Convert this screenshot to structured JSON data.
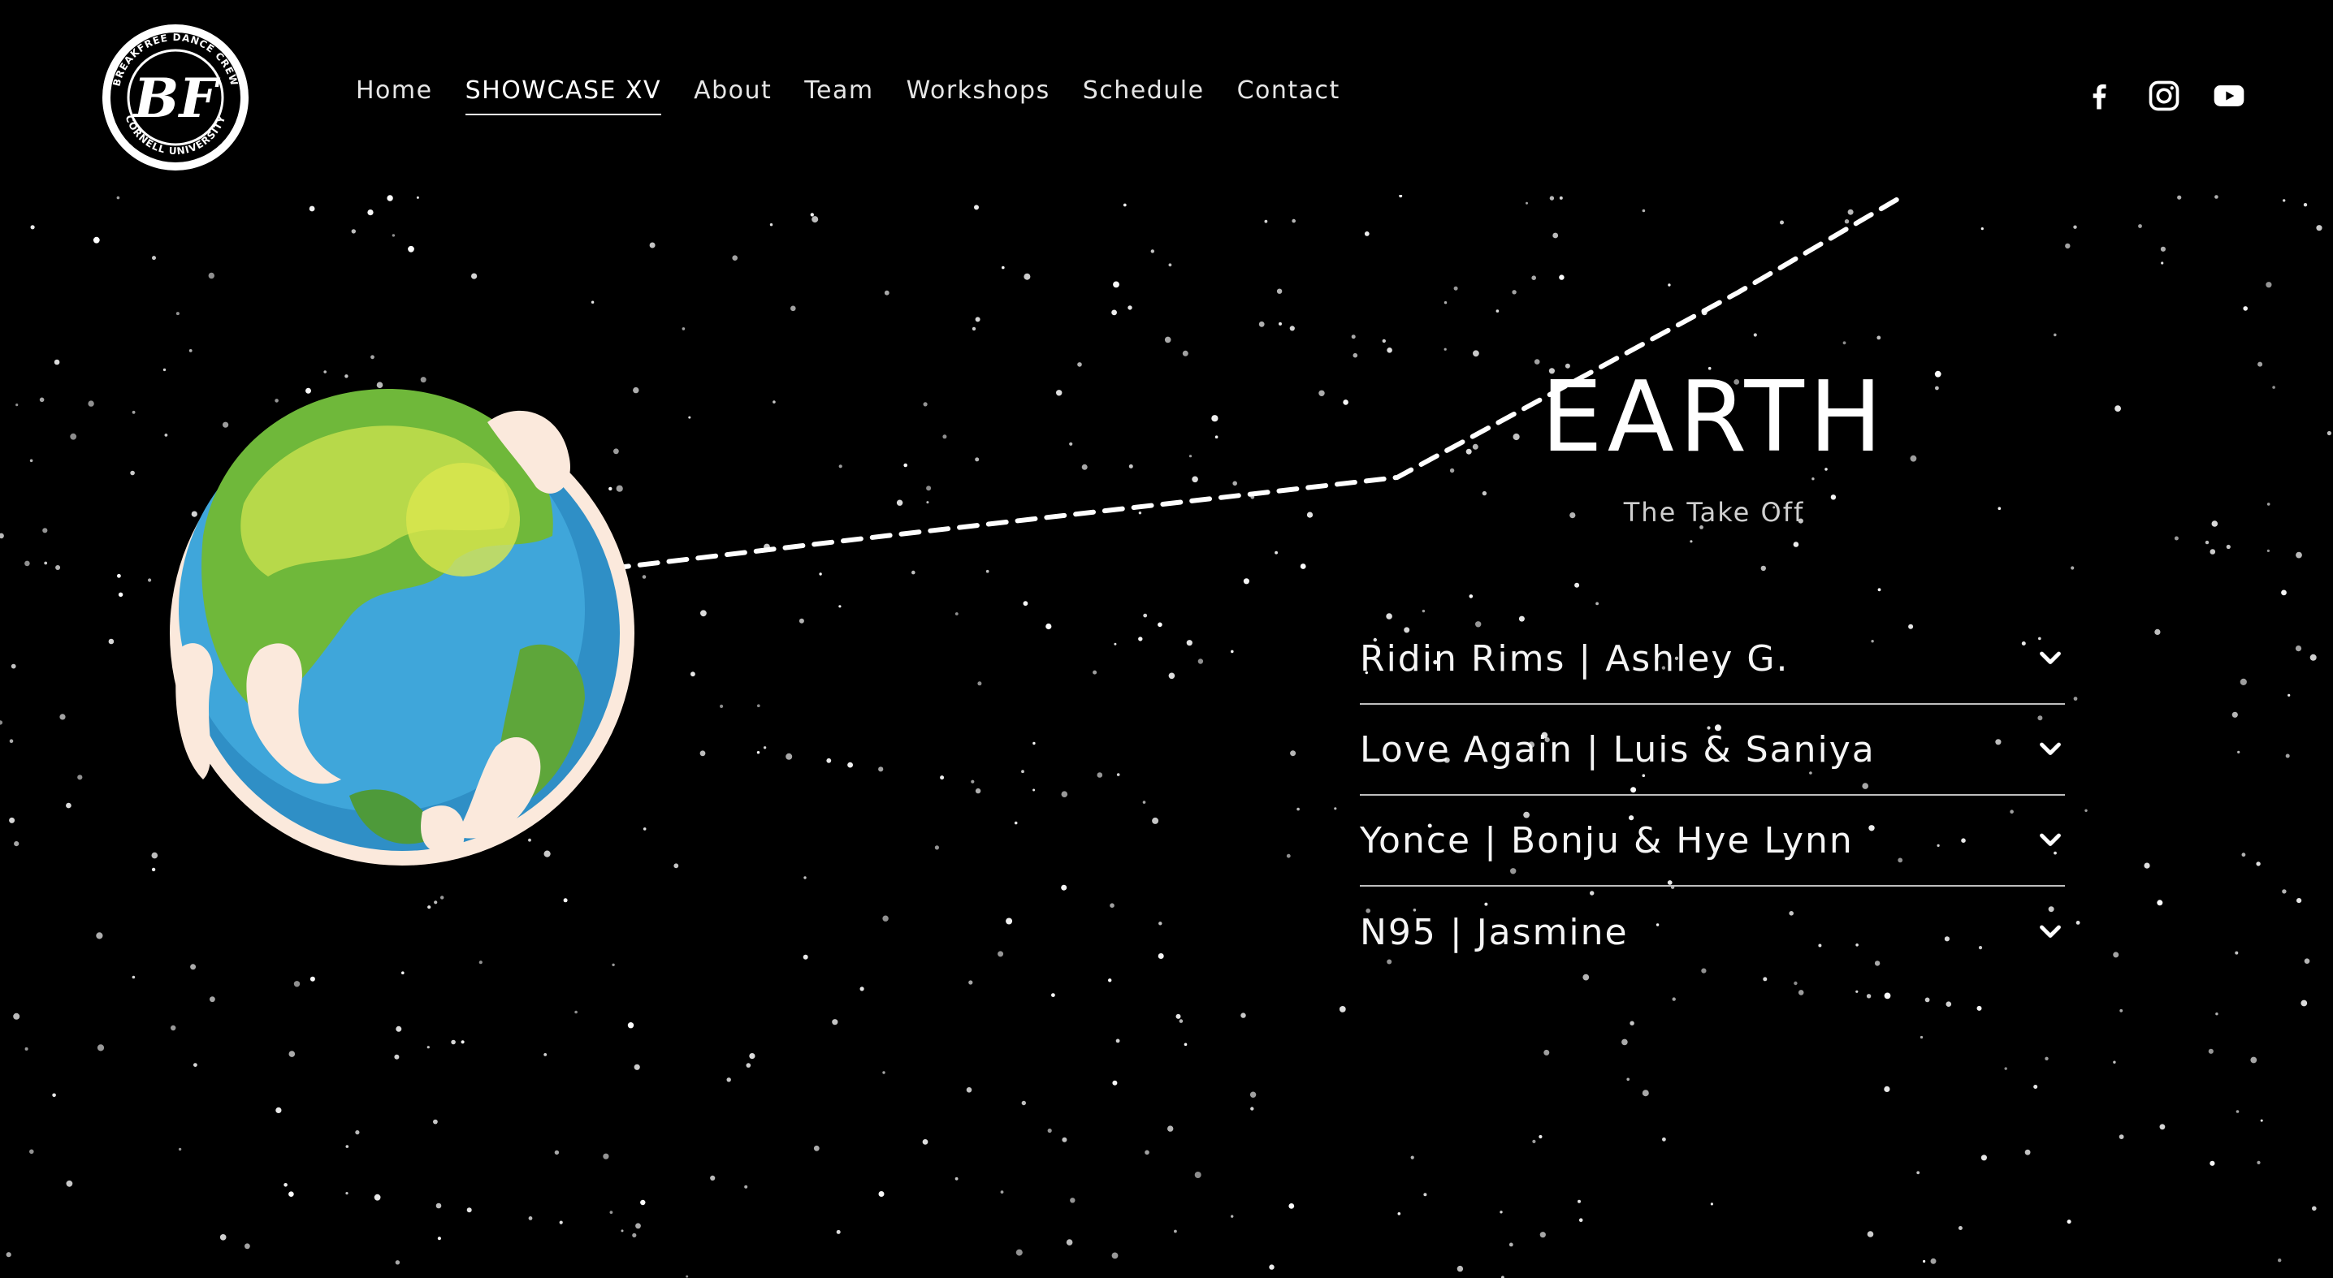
{
  "brand": {
    "logo_ring_text_top": "BREAKFREE DANCE CREW",
    "logo_ring_text_bottom": "CORNELL UNIVERSITY",
    "logo_monogram": "BF"
  },
  "nav": {
    "items": [
      {
        "label": "Home",
        "active": false
      },
      {
        "label": "SHOWCASE XV",
        "active": true
      },
      {
        "label": "About",
        "active": false
      },
      {
        "label": "Team",
        "active": false
      },
      {
        "label": "Workshops",
        "active": false
      },
      {
        "label": "Schedule",
        "active": false
      },
      {
        "label": "Contact",
        "active": false
      }
    ]
  },
  "social": {
    "icons": [
      "facebook-icon",
      "instagram-icon",
      "youtube-icon"
    ]
  },
  "planet": {
    "title": "EARTH",
    "subtitle": "The Take Off"
  },
  "performances": {
    "items": [
      {
        "label": "Ridin Rims | Ashley G."
      },
      {
        "label": "Love Again | Luis & Saniya"
      },
      {
        "label": "Yonce | Bonju & Hye Lynn"
      },
      {
        "label": "N95 | Jasmine"
      }
    ],
    "expand_icon": "chevron-down-icon"
  },
  "colors": {
    "background": "#000000",
    "text": "#ffffff",
    "divider": "#bfbfbf",
    "ocean": "#3a9fd2",
    "land": "#8cc63f",
    "cloud": "#fbe9dc"
  }
}
